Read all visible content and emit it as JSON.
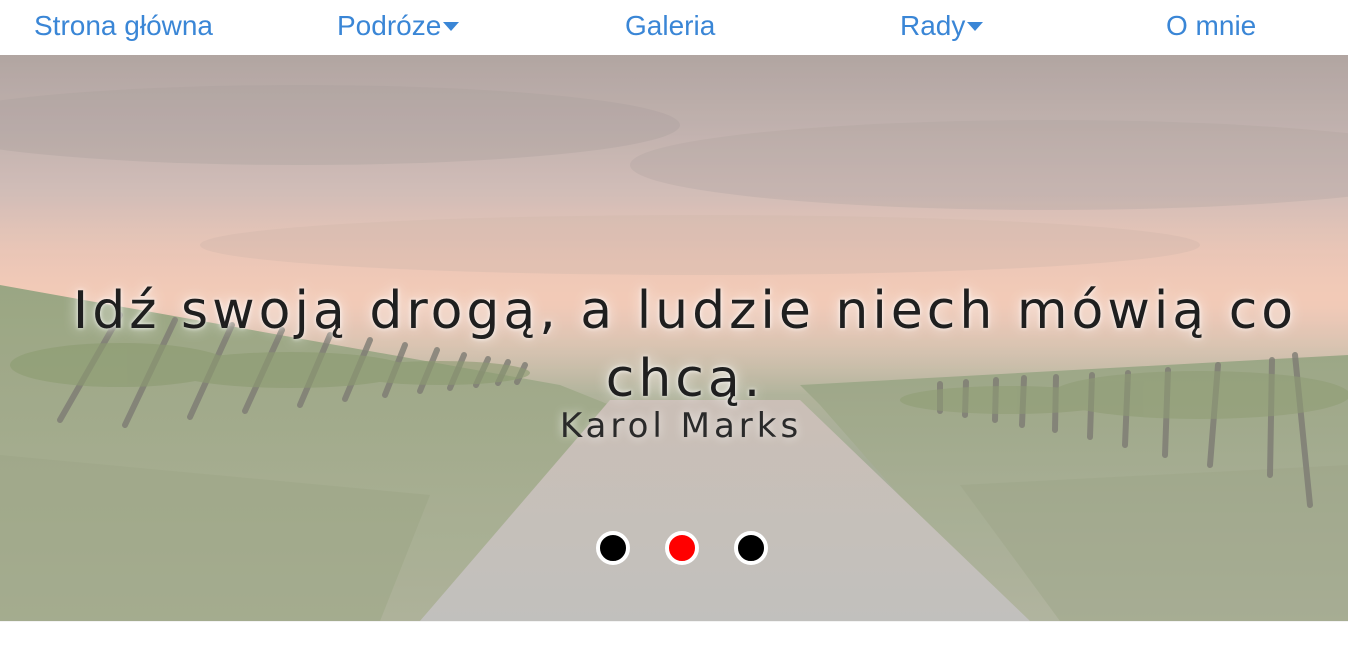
{
  "nav": {
    "items": [
      {
        "label": "Strona główna",
        "has_dropdown": false
      },
      {
        "label": "Podróze",
        "has_dropdown": true
      },
      {
        "label": "Galeria",
        "has_dropdown": false
      },
      {
        "label": "Rady",
        "has_dropdown": true
      },
      {
        "label": "O mnie",
        "has_dropdown": false
      }
    ],
    "link_color": "#3a86d6"
  },
  "hero": {
    "quote": "Idź swoją drogą, a ludzie niech mówią co chcą.",
    "author": "Karol Marks",
    "slides": {
      "count": 3,
      "active_index": 2,
      "active_color": "#ff0000",
      "inactive_color": "#000000"
    }
  }
}
